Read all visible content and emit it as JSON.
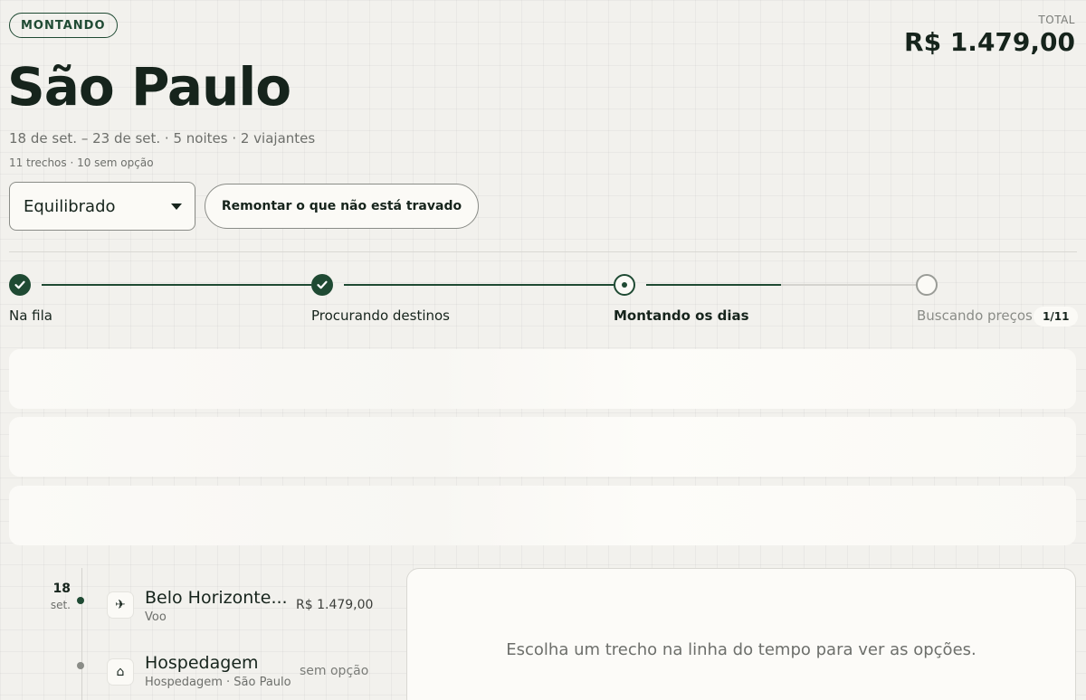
{
  "header": {
    "status": "MONTANDO",
    "title": "São Paulo",
    "meta": "18 de set. – 23 de set. · 5 noites · 2 viajantes",
    "sub": "11 trechos · 10 sem opção",
    "total_label": "TOTAL",
    "total_value": "R$ 1.479,00"
  },
  "controls": {
    "mode_selected": "Equilibrado",
    "rebuild_label": "Remontar o que não está travado"
  },
  "progress": {
    "steps": [
      {
        "label": "Na fila",
        "state": "done"
      },
      {
        "label": "Procurando destinos",
        "state": "done"
      },
      {
        "label": "Montando os dias",
        "state": "active"
      },
      {
        "label": "Buscando preços",
        "state": "pending"
      }
    ],
    "count": "1/11"
  },
  "timeline": {
    "day": "18",
    "month": "set.",
    "items": [
      {
        "icon": "plane-icon",
        "title": "Belo Horizonte...",
        "subtitle": "Voo",
        "price": "R$ 1.479,00"
      },
      {
        "icon": "home-icon",
        "title": "Hospedagem",
        "subtitle": "Hospedagem · São Paulo",
        "price": "sem opção"
      }
    ]
  },
  "detail": {
    "hint": "Escolha um trecho na linha do tempo para ver as opções."
  },
  "colors": {
    "accent": "#1f4a33",
    "background": "#f2f1ed"
  }
}
